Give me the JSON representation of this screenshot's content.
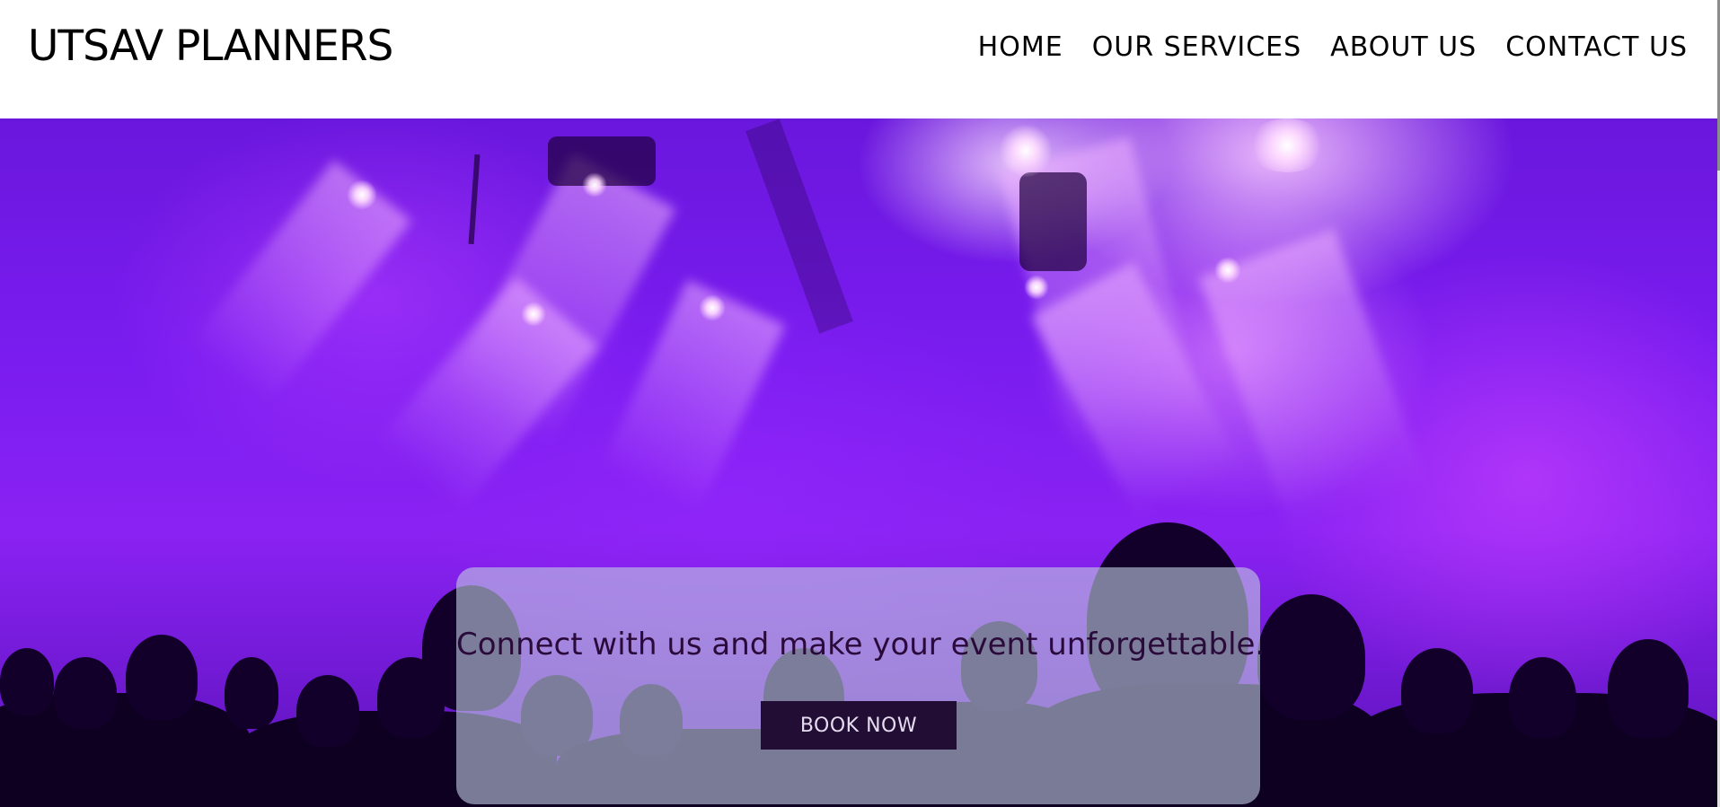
{
  "header": {
    "logo": "UTSAV PLANNERS",
    "nav": [
      {
        "label": "HOME"
      },
      {
        "label": "OUR SERVICES"
      },
      {
        "label": "ABOUT US"
      },
      {
        "label": "CONTACT US"
      }
    ]
  },
  "hero": {
    "background_icon": "concert-stage-lights-image",
    "cta": {
      "text": "Connect with us and make your event unforgettable.",
      "button_label": "BOOK NOW"
    }
  },
  "colors": {
    "header_bg": "#ffffff",
    "text": "#000000",
    "hero_accent": "#8a22f3",
    "button_bg": "#220d35",
    "button_text": "#e6dcf0"
  }
}
